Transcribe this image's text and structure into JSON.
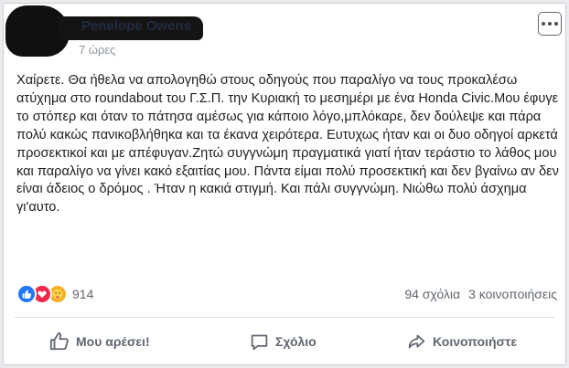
{
  "post": {
    "author": "Penelope Owens",
    "time": "7 ώρες",
    "text": "Χαίρετε. Θα ήθελα να απολογηθώ στους οδηγούς που παραλίγο να τους προκαλέσω ατύχημα στο roundabout του Γ.Σ.Π. την Κυριακή το μεσημέρι με ένα Honda Civic.Μου έφυγε το στόπερ και όταν το πάτησα αμέσως για κάποιο λόγο,μπλόκαρε, δεν δούλεψε και πάρα πολύ κακώς πανικοβλήθηκα και τα έκανα χειρότερα. Ευτυχως ήταν και οι δυο οδηγοί αρκετά προσεκτικοί και με απέφυγαν.Ζητώ συγγνώμη πραγματικά γιατί ήταν τεράστιο το λάθος μου και παραλίγο να γίνει κακό εξαιτίας μου. Πάντα είμαι πολύ προσεκτική και δεν βγαίνω αν δεν είναι άδειος ο δρόμος . Ήταν η κακιά στιγμή. Και πάλι συγγνώμη. Νιώθω πολύ άσχημα γι'αυτο."
  },
  "stats": {
    "reactions_count": "914",
    "reaction_icons": [
      "like-icon",
      "love-icon",
      "care-icon"
    ],
    "comments": "94 σχόλια",
    "shares": "3 κοινοποιήσεις"
  },
  "actions": {
    "like": "Μου αρέσει!",
    "comment": "Σχόλιο",
    "share": "Κοινοποιήστε"
  },
  "colors": {
    "like": "#2078f4",
    "love": "#f0284a",
    "care": "#f7b125",
    "text": "#1c1e21",
    "secondary": "#606770"
  }
}
